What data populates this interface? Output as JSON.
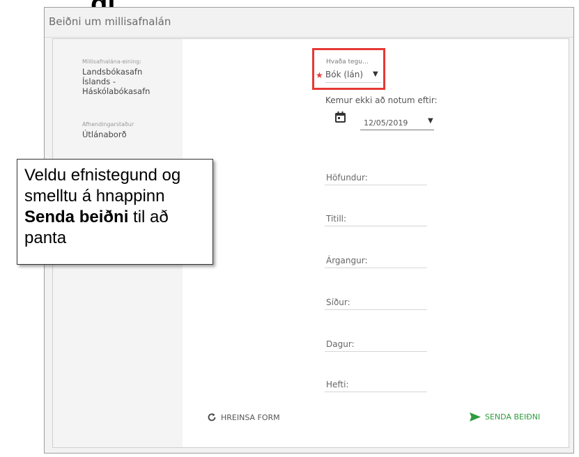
{
  "window": {
    "title": "Beiðni um millisafnalán"
  },
  "sidebar": {
    "unit_label": "Millisafnalána-eining:",
    "unit_value_lines": [
      "Landsbókasafn",
      "Íslands -",
      "Háskólabókasafn"
    ],
    "pickup_label": "Afhendingarstaður",
    "pickup_value": "Útlánaborð"
  },
  "form": {
    "type_select": {
      "label": "Hvaða tegu…",
      "value": "Bók (lán)",
      "required": true
    },
    "not_needed_after": {
      "label": "Kemur ekki að notum eftir:",
      "value": "12/05/2019"
    },
    "fields": [
      {
        "label": "Höfundur:"
      },
      {
        "label": "Titill:"
      },
      {
        "label": "Árgangur:"
      },
      {
        "label": "Síður:"
      },
      {
        "label": "Dagur:"
      },
      {
        "label": "Hefti:"
      }
    ],
    "clear_label": "HREINSA FORM",
    "send_label": "SENDA BEIÐNI"
  },
  "callout": {
    "parts": [
      "Veldu efnistegund og smelltu á hnappinn ",
      "Senda beiðni",
      " til að panta"
    ]
  },
  "colors": {
    "highlight": "#e53935",
    "send": "#2e9b3c",
    "required": "#e53935"
  },
  "icons": {
    "calendar": "calendar-icon",
    "clear": "refresh-icon",
    "send": "send-icon",
    "dropdown": "caret-down-icon"
  }
}
